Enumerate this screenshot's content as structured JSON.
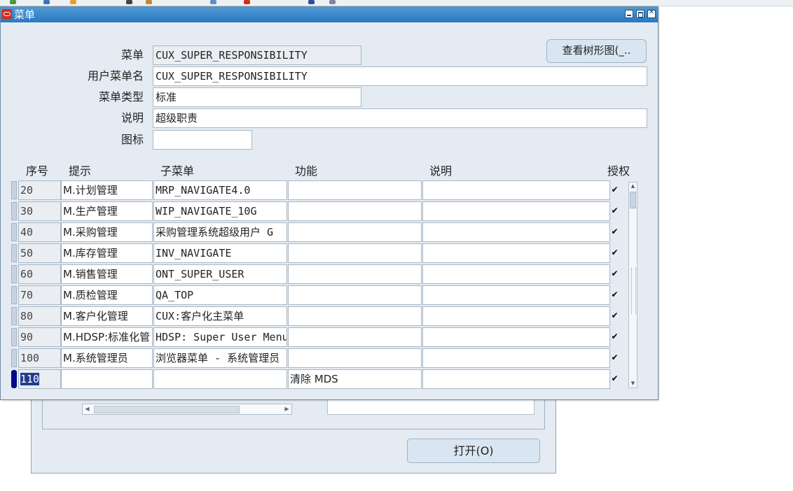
{
  "window": {
    "title": "菜单"
  },
  "form": {
    "menu_label": "菜单",
    "menu_value": "CUX_SUPER_RESPONSIBILITY",
    "user_menu_label": "用户菜单名",
    "user_menu_value": "CUX_SUPER_RESPONSIBILITY",
    "menu_type_label": "菜单类型",
    "menu_type_value": "标准",
    "description_label": "说明",
    "description_value": "超级职责",
    "icon_label": "图标",
    "icon_value": ""
  },
  "tree_button": {
    "label": "查看树形图(_.."
  },
  "grid": {
    "headers": {
      "seq": "序号",
      "prompt": "提示",
      "submenu": "子菜单",
      "function": "功能",
      "description": "说明",
      "grant": "授权"
    },
    "rows": [
      {
        "seq": "20",
        "prompt": "M.计划管理",
        "submenu": "MRP_NAVIGATE4.0",
        "function": "",
        "description": "",
        "granted": "✔"
      },
      {
        "seq": "30",
        "prompt": "M.生产管理",
        "submenu": "WIP_NAVIGATE_10G",
        "function": "",
        "description": "",
        "granted": "✔"
      },
      {
        "seq": "40",
        "prompt": "M.采购管理",
        "submenu": "采购管理系统超级用户 G",
        "function": "",
        "description": "",
        "granted": "✔"
      },
      {
        "seq": "50",
        "prompt": "M.库存管理",
        "submenu": "INV_NAVIGATE",
        "function": "",
        "description": "",
        "granted": "✔"
      },
      {
        "seq": "60",
        "prompt": "M.销售管理",
        "submenu": "ONT_SUPER_USER",
        "function": "",
        "description": "",
        "granted": "✔"
      },
      {
        "seq": "70",
        "prompt": "M.质检管理",
        "submenu": "QA_TOP",
        "function": "",
        "description": "",
        "granted": "✔"
      },
      {
        "seq": "80",
        "prompt": "M.客户化管理",
        "submenu": "CUX:客户化主菜单",
        "function": "",
        "description": "",
        "granted": "✔"
      },
      {
        "seq": "90",
        "prompt": "M.HDSP:标准化管",
        "submenu": "HDSP: Super User Menu",
        "function": "",
        "description": "",
        "granted": "✔"
      },
      {
        "seq": "100",
        "prompt": "M.系统管理员",
        "submenu": "浏览器菜单 - 系统管理员",
        "function": "",
        "description": "",
        "granted": "✔"
      },
      {
        "seq": "110",
        "prompt": "",
        "submenu": "",
        "function": "清除 MDS",
        "description": "",
        "granted": "✔"
      }
    ]
  },
  "background_window": {
    "open_button_label": "打开(O)"
  },
  "colors": {
    "title_bar": "#2a78bf",
    "window_bg": "#e4ebf2",
    "active_row": "#000a8a"
  }
}
